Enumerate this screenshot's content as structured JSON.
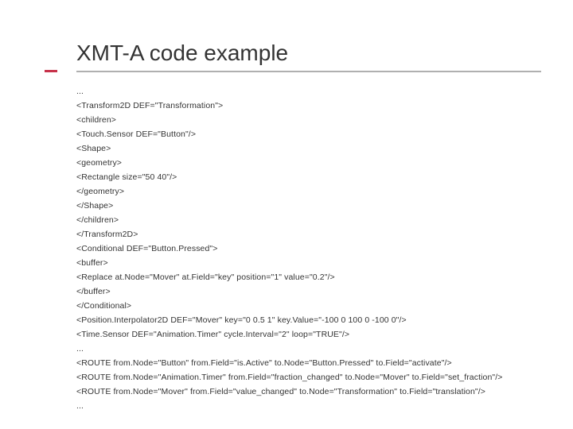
{
  "title": "XMT-A code example",
  "code_lines": [
    "...",
    "<Transform2D DEF=\"Transformation\">",
    "<children>",
    "<Touch.Sensor DEF=\"Button\"/>",
    "<Shape>",
    "<geometry>",
    "<Rectangle size=\"50 40\"/>",
    "</geometry>",
    "</Shape>",
    "</children>",
    "</Transform2D>",
    "<Conditional DEF=\"Button.Pressed\">",
    "<buffer>",
    "<Replace at.Node=\"Mover\" at.Field=\"key\" position=\"1\" value=\"0.2\"/>",
    "</buffer>",
    "</Conditional>",
    "<Position.Interpolator2D DEF=\"Mover\" key=\"0 0.5 1\" key.Value=\"-100 0 100 0 -100 0\"/>",
    "<Time.Sensor DEF=\"Animation.Timer\" cycle.Interval=\"2\" loop=\"TRUE\"/>",
    "...",
    "<ROUTE from.Node=\"Button\" from.Field=\"is.Active\" to.Node=\"Button.Pressed\" to.Field=\"activate\"/>",
    "<ROUTE from.Node=\"Animation.Timer\" from.Field=\"fraction_changed\" to.Node=\"Mover\" to.Field=\"set_fraction\"/>",
    "<ROUTE from.Node=\"Mover\" from.Field=\"value_changed\" to.Node=\"Transformation\" to.Field=\"translation\"/>",
    "..."
  ]
}
